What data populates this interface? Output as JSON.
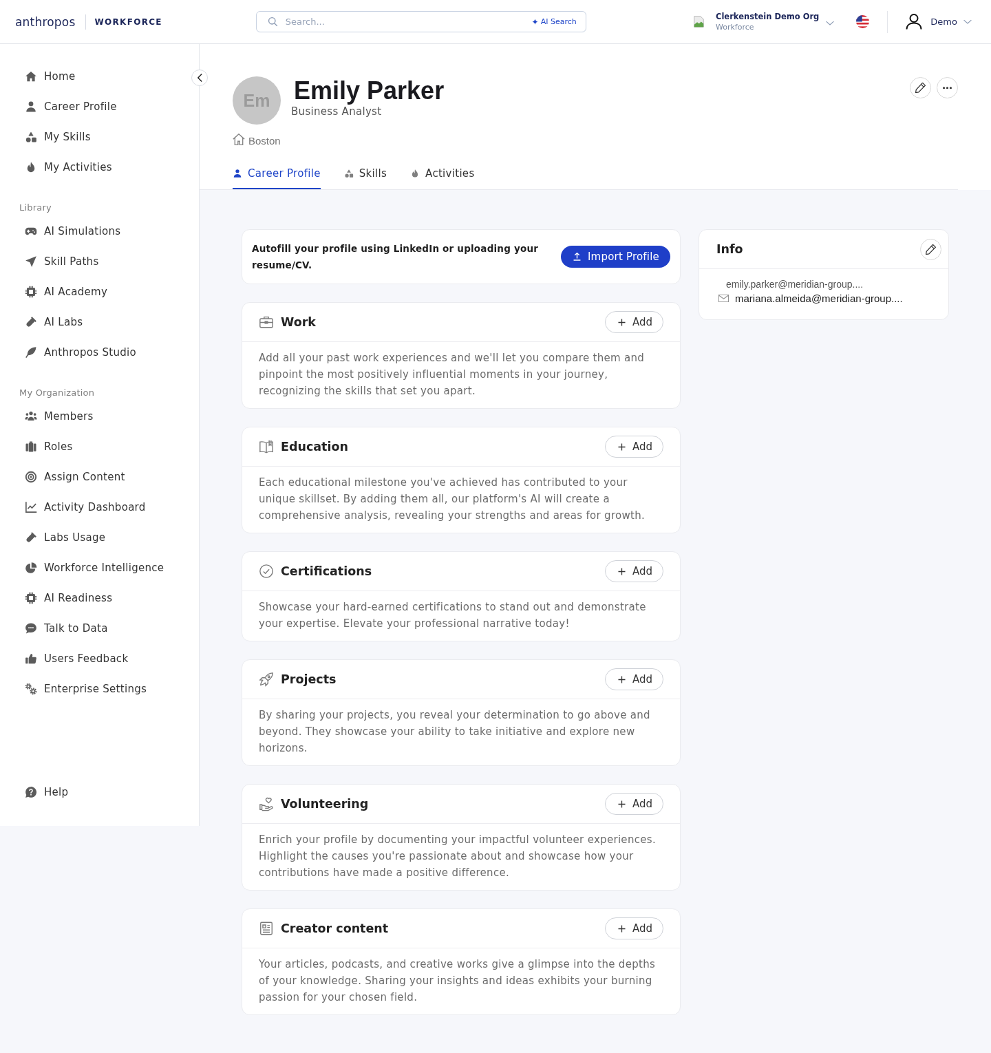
{
  "header": {
    "logo": "anthropos",
    "product": "WORKFORCE",
    "search": {
      "placeholder": "Search...",
      "ai_button": "AI Search"
    },
    "org": {
      "name": "Clerkenstein Demo Org",
      "subtitle": "Workforce"
    },
    "user": {
      "name": "Demo"
    }
  },
  "sidebar": {
    "sections": [
      {
        "items": [
          {
            "label": "Home",
            "selected": false
          },
          {
            "label": "Career Profile",
            "selected": false
          },
          {
            "label": "My Skills",
            "selected": false
          },
          {
            "label": "My Activities",
            "selected": false
          }
        ]
      },
      {
        "title": "Library",
        "items": [
          {
            "label": "AI Simulations",
            "selected": false
          },
          {
            "label": "Skill Paths",
            "selected": false
          },
          {
            "label": "AI Academy",
            "selected": false
          },
          {
            "label": "AI Labs",
            "selected": false
          },
          {
            "label": "Anthropos Studio",
            "selected": false
          }
        ]
      },
      {
        "title": "My Organization",
        "items": [
          {
            "label": "Members",
            "selected": false
          },
          {
            "label": "Roles",
            "selected": false
          },
          {
            "label": "Assign Content",
            "selected": false
          },
          {
            "label": "Activity Dashboard",
            "selected": false
          },
          {
            "label": "Labs Usage",
            "selected": false
          },
          {
            "label": "Workforce Intelligence",
            "selected": false
          },
          {
            "label": "AI Readiness",
            "selected": false
          },
          {
            "label": "Talk to Data",
            "selected": false
          },
          {
            "label": "Users Feedback",
            "selected": false
          },
          {
            "label": "Enterprise Settings",
            "selected": false
          }
        ]
      }
    ],
    "footer": [
      {
        "label": "Help",
        "selected": false
      }
    ]
  },
  "profile": {
    "initials": "Em",
    "name": "Emily Parker",
    "job_title": "Business Analyst",
    "location": "Boston"
  },
  "tabs": [
    {
      "label": "Career Profile",
      "selected": true
    },
    {
      "label": "Skills",
      "selected": false
    },
    {
      "label": "Activities",
      "selected": false
    }
  ],
  "autofill": {
    "text": "Autofill your profile using LinkedIn or uploading your resume/CV.",
    "button": "Import Profile"
  },
  "sections": [
    {
      "title": "Work",
      "button": "Add",
      "description": "Add all your past work experiences and we'll let you compare them and pinpoint the most positively influential moments in your journey, recognizing the skills that set you apart."
    },
    {
      "title": "Education",
      "button": "Add",
      "description": "Each educational milestone you've achieved has contributed to your unique skillset. By adding them all, our platform's AI will create a comprehensive analysis, revealing your strengths and areas for growth."
    },
    {
      "title": "Certifications",
      "button": "Add",
      "description": "Showcase your hard-earned certifications to stand out and demonstrate your expertise. Elevate your professional narrative today!"
    },
    {
      "title": "Projects",
      "button": "Add",
      "description": "By sharing your projects, you reveal your determination to go above and beyond. They showcase your ability to take initiative and explore new horizons."
    },
    {
      "title": "Volunteering",
      "button": "Add",
      "description": "Enrich your profile by documenting your impactful volunteer experiences. Highlight the causes you're passionate about and showcase how your contributions have made a positive difference."
    },
    {
      "title": "Creator content",
      "button": "Add",
      "description": "Your articles, podcasts, and creative works give a glimpse into the depths of your knowledge. Sharing your insights and ideas exhibits your burning passion for your chosen field."
    }
  ],
  "info": {
    "title": "Info",
    "label": "emily.parker@meridian-group....",
    "email": "mariana.almeida@meridian-group...."
  }
}
